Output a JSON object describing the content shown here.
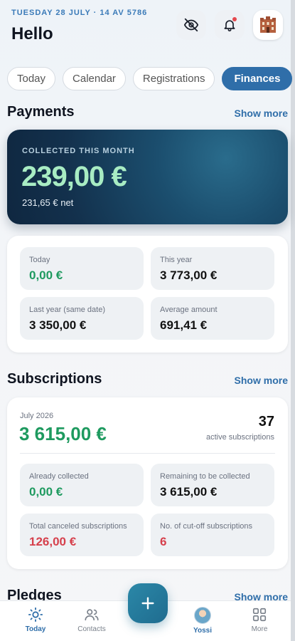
{
  "header": {
    "date": "TUESDAY 28 JULY · 14 AV 5786",
    "greeting": "Hello"
  },
  "tabs": [
    "Today",
    "Calendar",
    "Registrations",
    "Finances"
  ],
  "payments": {
    "title": "Payments",
    "show_more": "Show more",
    "collected_label": "COLLECTED THIS MONTH",
    "collected_amount": "239,00 €",
    "net": "231,65 € net",
    "tiles": [
      {
        "label": "Today",
        "value": "0,00 €"
      },
      {
        "label": "This year",
        "value": "3 773,00 €"
      },
      {
        "label": "Last year (same date)",
        "value": "3 350,00 €"
      },
      {
        "label": "Average amount",
        "value": "691,41 €"
      }
    ]
  },
  "subscriptions": {
    "title": "Subscriptions",
    "show_more": "Show more",
    "month": "July 2026",
    "amount": "3 615,00 €",
    "count": "37",
    "count_label": "active subscriptions",
    "tiles": [
      {
        "label": "Already collected",
        "value": "0,00 €"
      },
      {
        "label": "Remaining to be collected",
        "value": "3 615,00 €"
      },
      {
        "label": "Total canceled subscriptions",
        "value": "126,00 €"
      },
      {
        "label": "No. of cut-off subscriptions",
        "value": "6"
      }
    ]
  },
  "pledges": {
    "title": "Pledges",
    "show_more": "Show more"
  },
  "nav": {
    "today": "Today",
    "contacts": "Contacts",
    "user": "Yossi",
    "more": "More"
  },
  "colors": {
    "accent": "#2f6ea9",
    "positive": "#1e9a5f",
    "negative": "#d6404c",
    "hero_bg": "#13314d"
  },
  "icons": [
    "eye-off-icon",
    "bell-icon",
    "organization-logo-icon",
    "sun-icon",
    "contacts-icon",
    "plus-icon",
    "grid-icon"
  ]
}
